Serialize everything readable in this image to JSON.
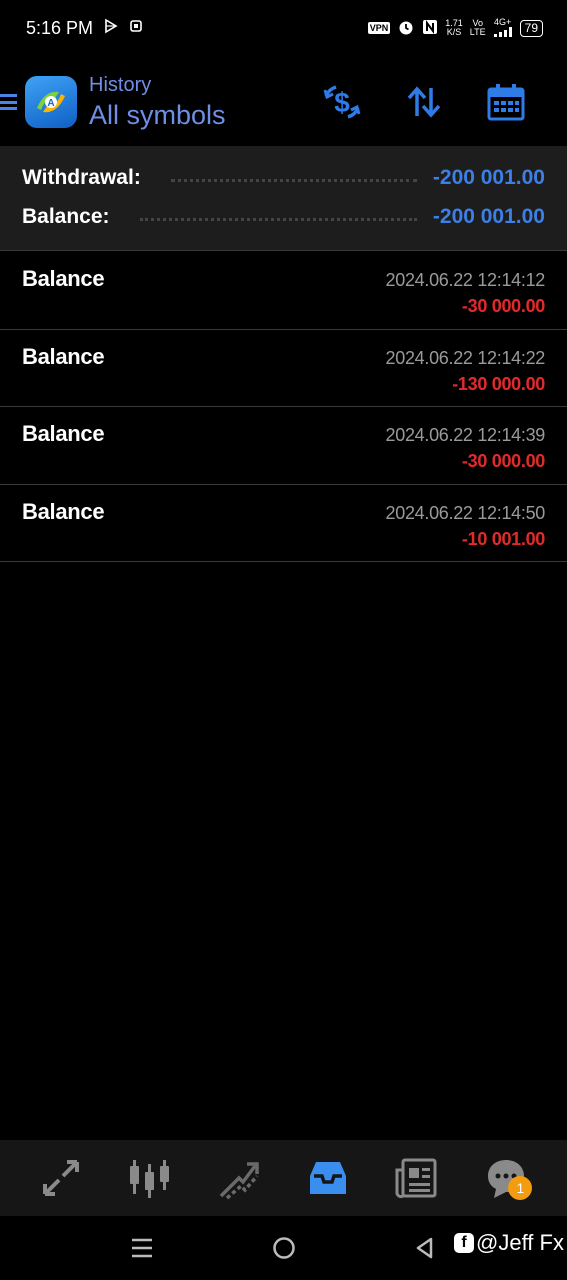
{
  "status_bar": {
    "time": "5:16 PM",
    "vpn": "VPN",
    "net_speed_top": "1.71",
    "net_speed_bottom": "K/S",
    "volte_top": "Vo",
    "volte_bottom": "LTE",
    "network": "4G+",
    "battery": "79"
  },
  "app_bar": {
    "subtitle": "History",
    "title": "All symbols"
  },
  "summary": {
    "withdrawal_label": "Withdrawal:",
    "withdrawal_value": "-200 001.00",
    "balance_label": "Balance:",
    "balance_value": "-200 001.00"
  },
  "operations": [
    {
      "label": "Balance",
      "time": "2024.06.22 12:14:12",
      "amount": "-30 000.00"
    },
    {
      "label": "Balance",
      "time": "2024.06.22 12:14:22",
      "amount": "-130 000.00"
    },
    {
      "label": "Balance",
      "time": "2024.06.22 12:14:39",
      "amount": "-30 000.00"
    },
    {
      "label": "Balance",
      "time": "2024.06.22 12:14:50",
      "amount": "-10 001.00"
    }
  ],
  "bottom_nav": {
    "items": [
      "quotes-icon",
      "chart-icon",
      "trade-icon",
      "history-icon",
      "news-icon",
      "chat-icon"
    ],
    "active": "history-icon",
    "chat_badge": "1"
  },
  "watermark": {
    "text": "@Jeff Fx",
    "fb_letter": "f"
  },
  "colors": {
    "accent_blue": "#3c7fe6",
    "negative_red": "#e22a2a",
    "active_tab": "#3a8ef0"
  }
}
